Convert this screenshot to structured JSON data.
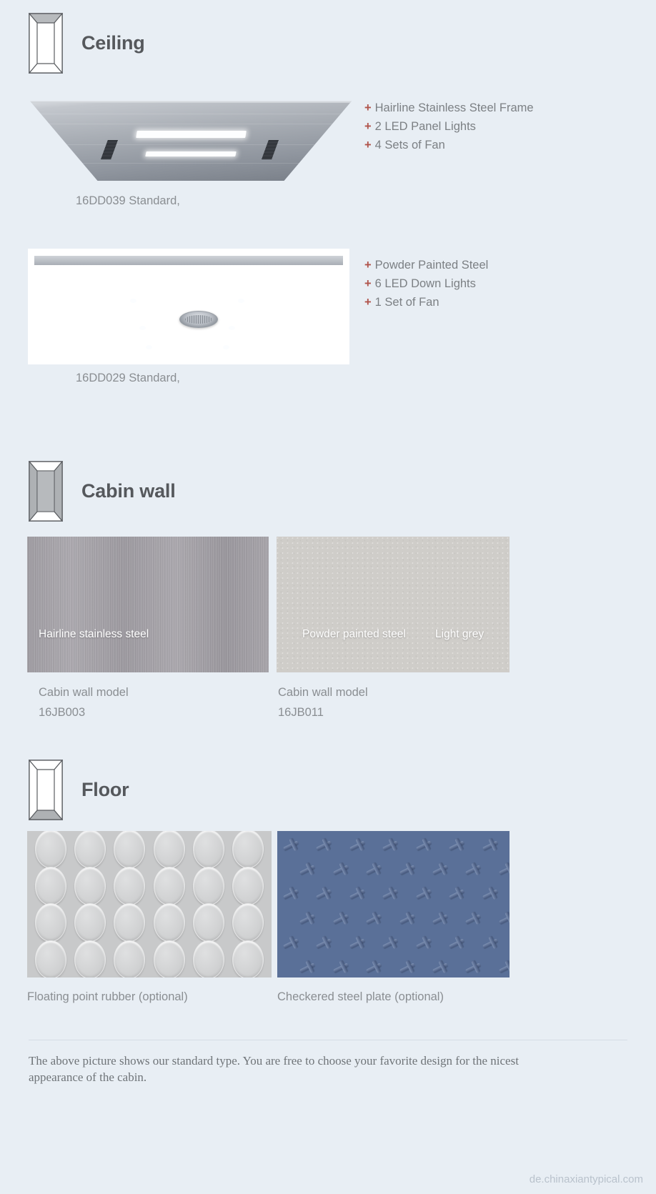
{
  "sections": [
    {
      "id": "ceiling",
      "title": "Ceiling",
      "icon": "cabin-ceiling-icon"
    },
    {
      "id": "cabin-wall",
      "title": "Cabin wall",
      "icon": "cabin-wall-icon"
    },
    {
      "id": "floor",
      "title": "Floor",
      "icon": "cabin-floor-icon"
    }
  ],
  "ceiling": {
    "items": [
      {
        "caption": "16DD039 Standard,",
        "features": [
          "Hairline Stainless Steel Frame",
          "2 LED Panel Lights",
          "4 Sets of Fan"
        ]
      },
      {
        "caption": "16DD029 Standard,",
        "features": [
          "Powder Painted Steel",
          "6 LED Down Lights",
          "1 Set of Fan"
        ]
      }
    ],
    "bullet": "+"
  },
  "cabin_wall": {
    "swatches": [
      {
        "labels": [
          "Hairline stainless steel"
        ],
        "caption_line1": "Cabin wall model",
        "caption_line2": "16JB003",
        "color": "#a09da3"
      },
      {
        "labels": [
          "Powder painted steel",
          "Light grey"
        ],
        "caption_line1": "Cabin wall model",
        "caption_line2": "16JB011",
        "color": "#cfcdc9"
      }
    ]
  },
  "floor": {
    "swatches": [
      {
        "caption": "Floating point rubber (optional)",
        "color": "#c8c9ca"
      },
      {
        "caption": "Checkered steel plate (optional)",
        "color": "#5a7098"
      }
    ]
  },
  "footer": {
    "note": "The above picture shows our standard type. You are free to choose your favorite design for the nicest appearance of the cabin.",
    "watermark": "de.chinaxiantypical.com"
  },
  "colors": {
    "background": "#e8eef4",
    "heading": "#55585c",
    "body_text": "#7c8084",
    "bullet_accent": "#b0544b",
    "watermark": "#b9c2cc"
  }
}
